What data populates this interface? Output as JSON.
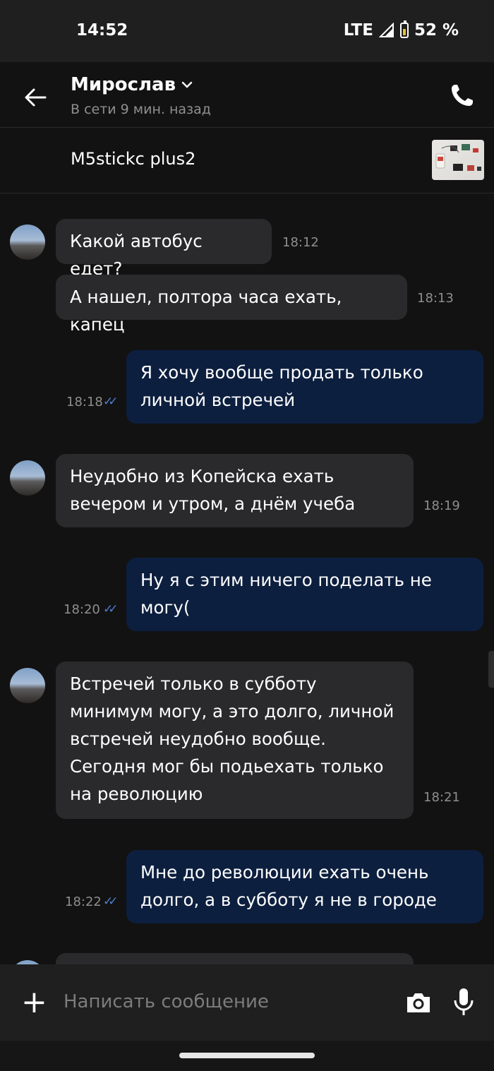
{
  "status_bar": {
    "time": "14:52",
    "network": "LTE",
    "battery": "52 %"
  },
  "header": {
    "contact_name": "Мирослав",
    "presence": "В сети 9 мин. назад",
    "icons": {
      "back": "arrow-left-icon",
      "call": "phone-icon",
      "expand": "chevron-down-icon"
    }
  },
  "product": {
    "title": "M5stickc plus2"
  },
  "messages": [
    {
      "direction": "in",
      "text": "Какой автобус едет?",
      "time": "18:12"
    },
    {
      "direction": "in",
      "text": "А нашел, полтора часа ехать, капец",
      "time": "18:13"
    },
    {
      "direction": "out",
      "text": "Я хочу вообще продать только личной встречей",
      "time": "18:18",
      "read": true
    },
    {
      "direction": "in",
      "text": "Неудобно из Копейска ехать вечером и утром, а днём учеба",
      "time": "18:19"
    },
    {
      "direction": "out",
      "text": "Ну я с этим ничего поделать не могу(",
      "time": "18:20",
      "read": true
    },
    {
      "direction": "in",
      "text": "Встречей только в субботу минимум могу, а это долго, личной встречей неудобно вообще. Сегодня мог бы подьехать только на революцию",
      "time": "18:21"
    },
    {
      "direction": "out",
      "text": "Мне до революции ехать очень долго, а в субботу я не в городе",
      "time": "18:22",
      "read": true
    }
  ],
  "composer": {
    "placeholder": "Написать сообщение",
    "icons": {
      "attach": "plus-icon",
      "camera": "camera-icon",
      "voice": "microphone-icon"
    }
  },
  "colors": {
    "background": "#121212",
    "incoming_bubble": "#2a2a2c",
    "outgoing_bubble": "#0d1f3f",
    "read_check": "#4d7fcf",
    "secondary_text": "#8f8f8f"
  }
}
